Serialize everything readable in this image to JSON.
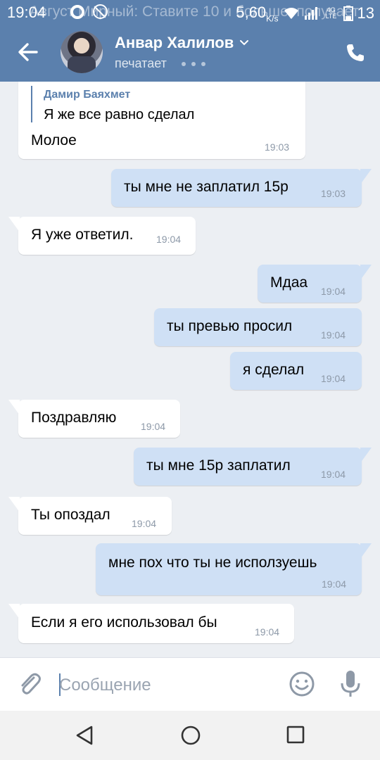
{
  "status_bar": {
    "time": "19:04",
    "notification": "Август Мирный: Ставите 10 и больше, получает",
    "speed": "5,60",
    "speed_unit": "K/s",
    "network": "4G LTE",
    "battery": "13"
  },
  "header": {
    "contact_name": "Анвар Халилов",
    "status": "печатает"
  },
  "messages": [
    {
      "dir": "in",
      "quote_author": "Дамир Баяхмет",
      "quote_text": "Я же все равно сделал",
      "text": "Молое",
      "time": "19:03"
    },
    {
      "dir": "out",
      "text": "ты мне не заплатил 15р",
      "time": "19:03"
    },
    {
      "dir": "in",
      "text": "Я уже ответил.",
      "time": "19:04"
    },
    {
      "dir": "out",
      "text": "Мдаа",
      "time": "19:04"
    },
    {
      "dir": "out",
      "text": "ты превью просил",
      "time": "19:04"
    },
    {
      "dir": "out",
      "text": "я сделал",
      "time": "19:04"
    },
    {
      "dir": "in",
      "text": "Поздравляю",
      "time": "19:04"
    },
    {
      "dir": "out",
      "text": "ты мне 15р заплатил",
      "time": "19:04"
    },
    {
      "dir": "in",
      "text": "Ты опоздал",
      "time": "19:04"
    },
    {
      "dir": "out",
      "text": "мне пох что ты не исползуешь",
      "time": "19:04"
    },
    {
      "dir": "in",
      "text": "Если я его использовал бы",
      "time": "19:04"
    }
  ],
  "composer": {
    "placeholder": "Сообщение"
  },
  "colors": {
    "header": "#5b80ad",
    "outgoing_bubble": "#cfe0f5",
    "incoming_bubble": "#ffffff",
    "chat_background": "#eceff3",
    "time_text": "#8d99a8"
  },
  "icons": [
    "back-arrow-icon",
    "chevron-down-icon",
    "phone-icon",
    "paperclip-icon",
    "emoji-icon",
    "microphone-icon",
    "nav-back-icon",
    "nav-home-icon",
    "nav-recent-icon"
  ]
}
